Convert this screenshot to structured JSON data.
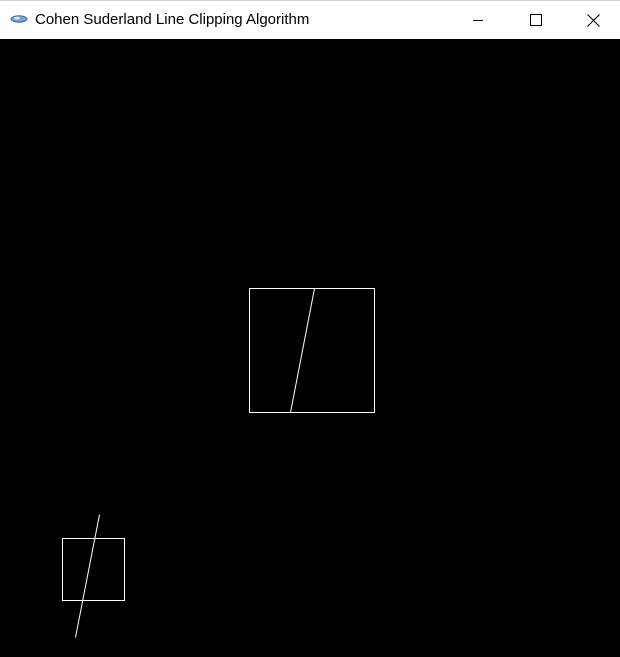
{
  "window": {
    "title": "Cohen Suderland Line Clipping Algorithm",
    "app_icon": "glut-app-icon",
    "controls": [
      "minimize-icon",
      "maximize-icon",
      "close-icon"
    ]
  },
  "canvas": {
    "background_color": "#000000",
    "stroke_color": "#ffffff",
    "content": [
      "original-clip-window",
      "original-line",
      "clipped-result-window",
      "clipped-line"
    ]
  }
}
